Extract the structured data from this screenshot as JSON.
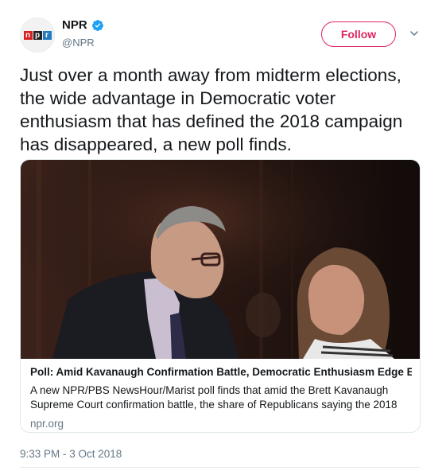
{
  "account": {
    "name": "NPR",
    "handle": "@NPR",
    "verified": true,
    "avatar_logo_letters": [
      "n",
      "p",
      "r"
    ],
    "avatar_icon": "npr-logo-icon"
  },
  "actions": {
    "follow_label": "Follow",
    "more_icon": "chevron-down-icon"
  },
  "tweet": {
    "text": "Just over a month away from midterm elections, the wide advantage in Democratic voter enthusiasm that has defined the 2018 campaign has disappeared, a new poll finds.",
    "timestamp": "9:33 PM - 3 Oct 2018"
  },
  "card": {
    "title": "Poll: Amid Kavanaugh Confirmation Battle, Democratic Enthusiasm Edge Evap...",
    "description": "A new NPR/PBS NewsHour/Marist poll finds that amid the Brett Kavanaugh Supreme Court confirmation battle, the share of Republicans saying the 2018",
    "domain": "npr.org"
  },
  "colors": {
    "follow_accent": "#e0245e",
    "verified_blue": "#1da1f2",
    "secondary_text": "#657786",
    "border": "#e1e8ed"
  }
}
